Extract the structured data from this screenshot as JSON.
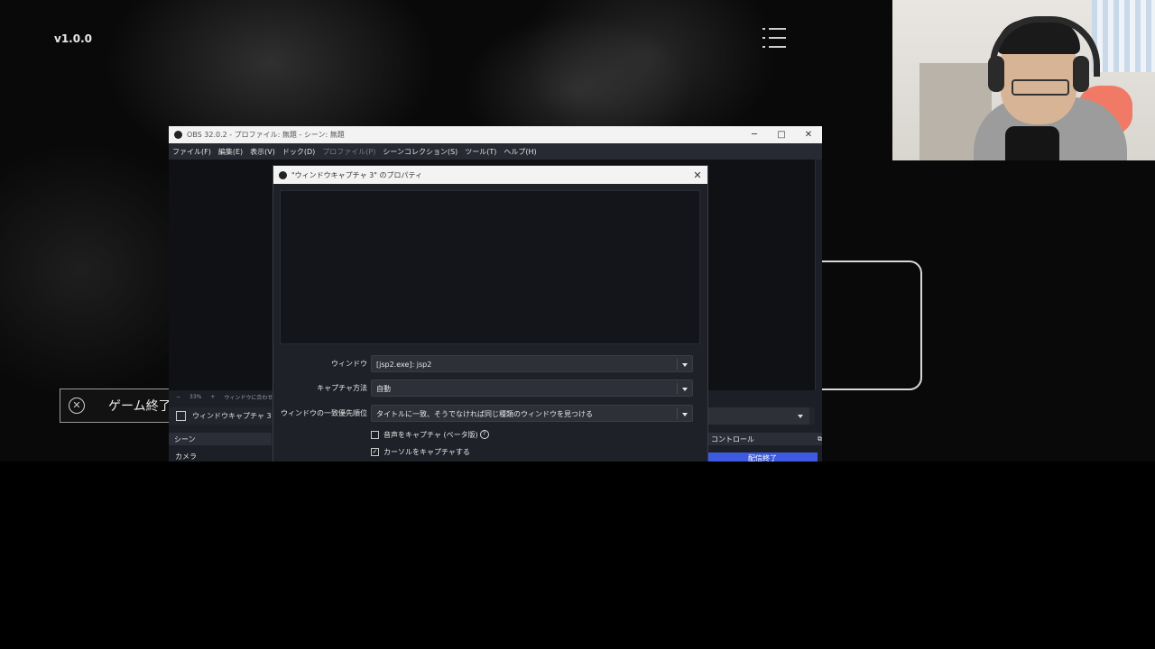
{
  "overlay": {
    "version": "v1.0.0",
    "game_end_label": "ゲーム終了"
  },
  "obs": {
    "window_title": "OBS 32.0.2 - プロファイル: 無題 - シーン: 無題",
    "window_controls": [
      "─",
      "□",
      "✕"
    ],
    "menu": [
      {
        "label": "ファイル(F)",
        "enabled": true
      },
      {
        "label": "編集(E)",
        "enabled": true
      },
      {
        "label": "表示(V)",
        "enabled": true
      },
      {
        "label": "ドック(D)",
        "enabled": true
      },
      {
        "label": "プロファイル(P)",
        "enabled": false
      },
      {
        "label": "シーンコレクション(S)",
        "enabled": true
      },
      {
        "label": "ツール(T)",
        "enabled": true
      },
      {
        "label": "ヘルプ(H)",
        "enabled": true
      }
    ],
    "zoom": {
      "minus": "−",
      "value": "33%",
      "plus": "+",
      "fit": "ウィンドウに合わせ"
    },
    "source_name": "ウィンドウキャプチャ 3",
    "docks": {
      "scenes": "シーン",
      "controls": "コントロール"
    },
    "scene_list": [
      "カメラ"
    ],
    "stream_button": "配信終了"
  },
  "dialog": {
    "title": "\"ウィンドウキャプチャ 3\" のプロパティ",
    "close": "✕",
    "fields": [
      {
        "label": "ウィンドウ",
        "value": "[jsp2.exe]: jsp2"
      },
      {
        "label": "キャプチャ方法",
        "value": "自動"
      },
      {
        "label": "ウィンドウの一致優先順位",
        "value": "タイトルに一致、そうでなければ同じ種類のウィンドウを見つける"
      }
    ],
    "checkboxes": [
      {
        "label": "音声をキャプチャ (ベータ版)",
        "checked": false,
        "help": "?"
      },
      {
        "label": "カーソルをキャプチャする",
        "checked": true
      }
    ]
  }
}
